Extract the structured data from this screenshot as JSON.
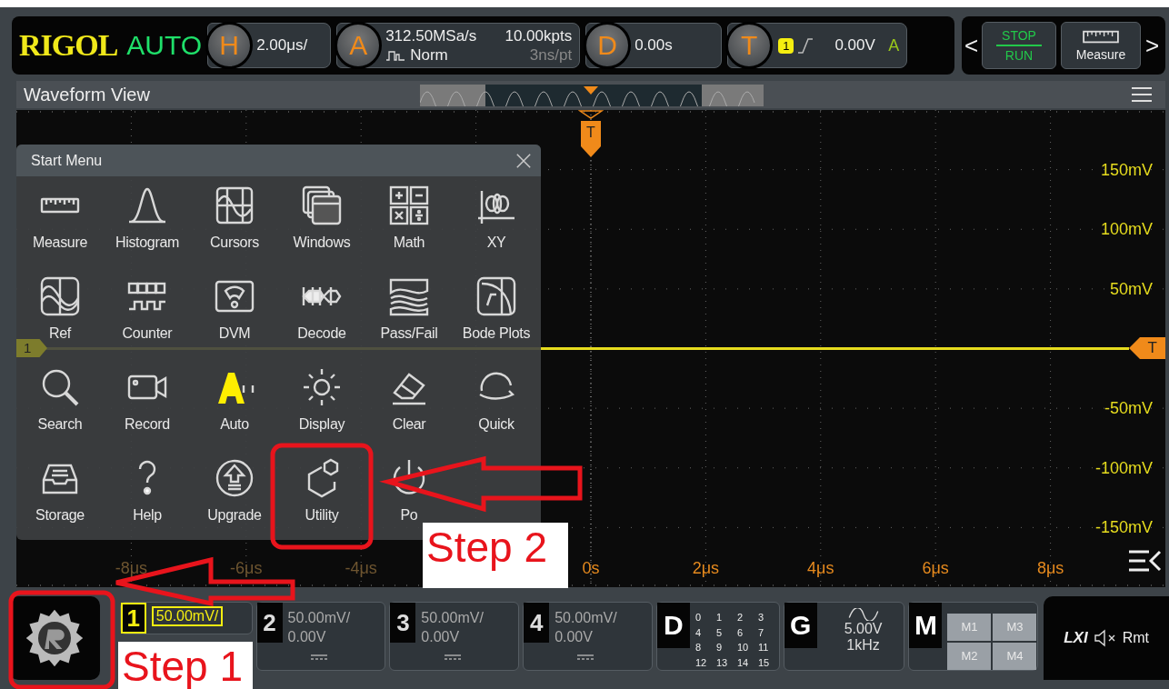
{
  "top_bar": {
    "logo": "RIGOL",
    "mode": "AUTO",
    "horizontal": {
      "letter": "H",
      "scale": "2.00μs/"
    },
    "acquire": {
      "letter": "A",
      "sample_rate": "312.50MSa/s",
      "memory_depth": "10.00kpts",
      "mode": "Norm",
      "resolution": "3ns/pt"
    },
    "delay": {
      "letter": "D",
      "value": "0.00s"
    },
    "trigger": {
      "letter": "T",
      "source": "1",
      "level": "0.00V",
      "sweep": "A"
    },
    "prev": "<",
    "run_stop": {
      "stop": "STOP",
      "run": "RUN"
    },
    "measure": "Measure",
    "next": ">"
  },
  "waveform_view": {
    "title": "Waveform View"
  },
  "plot": {
    "trigger_marker": "T",
    "level_marker": "T",
    "channel_marker": "1",
    "volt_labels_upper": [
      "150mV",
      "100mV",
      "50mV"
    ],
    "volt_labels_lower": [
      "-50mV",
      "-100mV",
      "-150mV"
    ],
    "time_labels_negative": [
      "-8μs",
      "-6μs",
      "-4μs"
    ],
    "time_labels_positive": [
      "0s",
      "2μs",
      "4μs",
      "6μs",
      "8μs"
    ]
  },
  "start_menu": {
    "title": "Start Menu",
    "items": [
      {
        "label": "Measure"
      },
      {
        "label": "Histogram"
      },
      {
        "label": "Cursors"
      },
      {
        "label": "Windows"
      },
      {
        "label": "Math"
      },
      {
        "label": "XY"
      },
      {
        "label": "Ref"
      },
      {
        "label": "Counter"
      },
      {
        "label": "DVM"
      },
      {
        "label": "Decode"
      },
      {
        "label": "Pass/Fail"
      },
      {
        "label": "Bode Plots"
      },
      {
        "label": "Search"
      },
      {
        "label": "Record"
      },
      {
        "label": "Auto"
      },
      {
        "label": "Display"
      },
      {
        "label": "Clear"
      },
      {
        "label": "Quick"
      },
      {
        "label": "Storage"
      },
      {
        "label": "Help"
      },
      {
        "label": "Upgrade"
      },
      {
        "label": "Utility"
      },
      {
        "label": "Po"
      }
    ]
  },
  "bottom_bar": {
    "channels": [
      {
        "number": "1",
        "scale": "50.00mV/",
        "active": true
      },
      {
        "number": "2",
        "scale": "50.00mV/",
        "offset": "0.00V",
        "active": false
      },
      {
        "number": "3",
        "scale": "50.00mV/",
        "offset": "0.00V",
        "active": false
      },
      {
        "number": "4",
        "scale": "50.00mV/",
        "offset": "0.00V",
        "active": false
      }
    ],
    "digital": {
      "letter": "D",
      "bits": [
        "0",
        "1",
        "2",
        "3",
        "4",
        "5",
        "6",
        "7",
        "8",
        "9",
        "10",
        "11",
        "12",
        "13",
        "14",
        "15"
      ]
    },
    "generator": {
      "letter": "G",
      "amplitude": "5.00V",
      "frequency": "1kHz"
    },
    "math": {
      "letter": "M",
      "slots": [
        "M1",
        "M3",
        "M2",
        "M4"
      ]
    },
    "status": {
      "lxi": "LXI",
      "remote": "Rmt"
    }
  },
  "annotations": [
    {
      "text": "Step 1"
    },
    {
      "text": "Step 2"
    }
  ]
}
